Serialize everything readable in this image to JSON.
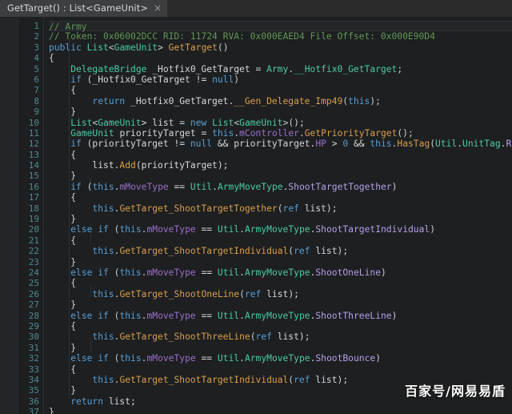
{
  "window": {
    "background_color": "#1d1f21",
    "accent_color": "#4ec9a7"
  },
  "tab_bar": {
    "tabs": [
      {
        "label": "GetTarget() : List<GameUnit>",
        "close_icon": "×",
        "active": true
      }
    ]
  },
  "editor": {
    "language": "csharp",
    "current_line": 1,
    "line_numbers": [
      "1",
      "2",
      "3",
      "4",
      "5",
      "6",
      "7",
      "8",
      "9",
      "10",
      "11",
      "12",
      "13",
      "14",
      "15",
      "16",
      "17",
      "18",
      "19",
      "20",
      "21",
      "22",
      "23",
      "24",
      "25",
      "26",
      "27",
      "28",
      "29",
      "30",
      "31",
      "32",
      "33",
      "34",
      "35",
      "36",
      "37"
    ],
    "colors": {
      "comment": "#629755",
      "keyword": "#5a9fd4",
      "type": "#4ec9a7",
      "method": "#d99f4b",
      "field": "#9b6fc9",
      "enum_member": "#b6a0e8",
      "number": "#6897bb",
      "plain": "#d8d8d8",
      "line_number": "#4f8a8b",
      "gutter_bg": "#1d1f21",
      "editor_bg": "#1d1f21",
      "current_line_bg": "#232629"
    },
    "lines": [
      {
        "n": 1,
        "tokens": [
          {
            "t": "// Army",
            "c": "cmt"
          }
        ]
      },
      {
        "n": 2,
        "tokens": [
          {
            "t": "// Token: 0x06002DCC RID: 11724 RVA: 0x000EAED4 File Offset: 0x000E90D4",
            "c": "cmt"
          }
        ]
      },
      {
        "n": 3,
        "tokens": [
          {
            "t": "public ",
            "c": "kw"
          },
          {
            "t": "List",
            "c": "type"
          },
          {
            "t": "<",
            "c": "punc"
          },
          {
            "t": "GameUnit",
            "c": "type"
          },
          {
            "t": "> ",
            "c": "punc"
          },
          {
            "t": "GetTarget",
            "c": "fn"
          },
          {
            "t": "()",
            "c": "punc"
          }
        ]
      },
      {
        "n": 4,
        "tokens": [
          {
            "t": "{",
            "c": "punc"
          }
        ]
      },
      {
        "n": 5,
        "tokens": [
          {
            "t": "    ",
            "c": "plain"
          },
          {
            "t": "DelegateBridge",
            "c": "type"
          },
          {
            "t": " _Hotfix0_GetTarget = ",
            "c": "plain"
          },
          {
            "t": "Army",
            "c": "type"
          },
          {
            "t": ".",
            "c": "punc"
          },
          {
            "t": "__Hotfix0_GetTarget",
            "c": "type"
          },
          {
            "t": ";",
            "c": "punc"
          }
        ]
      },
      {
        "n": 6,
        "tokens": [
          {
            "t": "    ",
            "c": "plain"
          },
          {
            "t": "if",
            "c": "kw"
          },
          {
            "t": " (_Hotfix0_GetTarget != ",
            "c": "plain"
          },
          {
            "t": "null",
            "c": "kw"
          },
          {
            "t": ")",
            "c": "punc"
          }
        ]
      },
      {
        "n": 7,
        "tokens": [
          {
            "t": "    {",
            "c": "punc"
          }
        ]
      },
      {
        "n": 8,
        "tokens": [
          {
            "t": "        ",
            "c": "plain"
          },
          {
            "t": "return",
            "c": "kw"
          },
          {
            "t": " _Hotfix0_GetTarget.",
            "c": "plain"
          },
          {
            "t": "__Gen_Delegate_Imp49",
            "c": "fn"
          },
          {
            "t": "(",
            "c": "punc"
          },
          {
            "t": "this",
            "c": "kw"
          },
          {
            "t": ");",
            "c": "punc"
          }
        ]
      },
      {
        "n": 9,
        "tokens": [
          {
            "t": "    }",
            "c": "punc"
          }
        ]
      },
      {
        "n": 10,
        "tokens": [
          {
            "t": "    ",
            "c": "plain"
          },
          {
            "t": "List",
            "c": "type"
          },
          {
            "t": "<",
            "c": "punc"
          },
          {
            "t": "GameUnit",
            "c": "type"
          },
          {
            "t": "> list = ",
            "c": "plain"
          },
          {
            "t": "new",
            "c": "kw"
          },
          {
            "t": " ",
            "c": "plain"
          },
          {
            "t": "List",
            "c": "type"
          },
          {
            "t": "<",
            "c": "punc"
          },
          {
            "t": "GameUnit",
            "c": "type"
          },
          {
            "t": ">();",
            "c": "punc"
          }
        ]
      },
      {
        "n": 11,
        "tokens": [
          {
            "t": "    ",
            "c": "plain"
          },
          {
            "t": "GameUnit",
            "c": "type"
          },
          {
            "t": " priorityTarget = ",
            "c": "plain"
          },
          {
            "t": "this",
            "c": "kw"
          },
          {
            "t": ".",
            "c": "punc"
          },
          {
            "t": "mController",
            "c": "field"
          },
          {
            "t": ".",
            "c": "punc"
          },
          {
            "t": "GetPriorityTarget",
            "c": "fn"
          },
          {
            "t": "();",
            "c": "punc"
          }
        ]
      },
      {
        "n": 12,
        "tokens": [
          {
            "t": "    ",
            "c": "plain"
          },
          {
            "t": "if",
            "c": "kw"
          },
          {
            "t": " (priorityTarget != ",
            "c": "plain"
          },
          {
            "t": "null",
            "c": "kw"
          },
          {
            "t": " && priorityTarget.",
            "c": "plain"
          },
          {
            "t": "HP",
            "c": "field"
          },
          {
            "t": " > ",
            "c": "plain"
          },
          {
            "t": "0",
            "c": "num"
          },
          {
            "t": " && ",
            "c": "plain"
          },
          {
            "t": "this",
            "c": "kw"
          },
          {
            "t": ".",
            "c": "punc"
          },
          {
            "t": "HasTag",
            "c": "fn"
          },
          {
            "t": "(",
            "c": "punc"
          },
          {
            "t": "Util",
            "c": "type"
          },
          {
            "t": ".",
            "c": "punc"
          },
          {
            "t": "UnitTag",
            "c": "type"
          },
          {
            "t": ".",
            "c": "punc"
          },
          {
            "t": "Ranger",
            "c": "enum"
          },
          {
            "t": "))",
            "c": "punc"
          }
        ]
      },
      {
        "n": 13,
        "tokens": [
          {
            "t": "    {",
            "c": "punc"
          }
        ]
      },
      {
        "n": 14,
        "tokens": [
          {
            "t": "        list.",
            "c": "plain"
          },
          {
            "t": "Add",
            "c": "fn"
          },
          {
            "t": "(priorityTarget);",
            "c": "plain"
          }
        ]
      },
      {
        "n": 15,
        "tokens": [
          {
            "t": "    }",
            "c": "punc"
          }
        ]
      },
      {
        "n": 16,
        "tokens": [
          {
            "t": "    ",
            "c": "plain"
          },
          {
            "t": "if",
            "c": "kw"
          },
          {
            "t": " (",
            "c": "punc"
          },
          {
            "t": "this",
            "c": "kw"
          },
          {
            "t": ".",
            "c": "punc"
          },
          {
            "t": "mMoveType",
            "c": "field"
          },
          {
            "t": " == ",
            "c": "plain"
          },
          {
            "t": "Util",
            "c": "type"
          },
          {
            "t": ".",
            "c": "punc"
          },
          {
            "t": "ArmyMoveType",
            "c": "type"
          },
          {
            "t": ".",
            "c": "punc"
          },
          {
            "t": "ShootTargetTogether",
            "c": "enum"
          },
          {
            "t": ")",
            "c": "punc"
          }
        ]
      },
      {
        "n": 17,
        "tokens": [
          {
            "t": "    {",
            "c": "punc"
          }
        ]
      },
      {
        "n": 18,
        "tokens": [
          {
            "t": "        ",
            "c": "plain"
          },
          {
            "t": "this",
            "c": "kw"
          },
          {
            "t": ".",
            "c": "punc"
          },
          {
            "t": "GetTarget_ShootTargetTogether",
            "c": "fn"
          },
          {
            "t": "(",
            "c": "punc"
          },
          {
            "t": "ref",
            "c": "kw"
          },
          {
            "t": " list);",
            "c": "plain"
          }
        ]
      },
      {
        "n": 19,
        "tokens": [
          {
            "t": "    }",
            "c": "punc"
          }
        ]
      },
      {
        "n": 20,
        "tokens": [
          {
            "t": "    ",
            "c": "plain"
          },
          {
            "t": "else if",
            "c": "kw"
          },
          {
            "t": " (",
            "c": "punc"
          },
          {
            "t": "this",
            "c": "kw"
          },
          {
            "t": ".",
            "c": "punc"
          },
          {
            "t": "mMoveType",
            "c": "field"
          },
          {
            "t": " == ",
            "c": "plain"
          },
          {
            "t": "Util",
            "c": "type"
          },
          {
            "t": ".",
            "c": "punc"
          },
          {
            "t": "ArmyMoveType",
            "c": "type"
          },
          {
            "t": ".",
            "c": "punc"
          },
          {
            "t": "ShootTargetIndividual",
            "c": "enum"
          },
          {
            "t": ")",
            "c": "punc"
          }
        ]
      },
      {
        "n": 21,
        "tokens": [
          {
            "t": "    {",
            "c": "punc"
          }
        ]
      },
      {
        "n": 22,
        "tokens": [
          {
            "t": "        ",
            "c": "plain"
          },
          {
            "t": "this",
            "c": "kw"
          },
          {
            "t": ".",
            "c": "punc"
          },
          {
            "t": "GetTarget_ShootTargetIndividual",
            "c": "fn"
          },
          {
            "t": "(",
            "c": "punc"
          },
          {
            "t": "ref",
            "c": "kw"
          },
          {
            "t": " list);",
            "c": "plain"
          }
        ]
      },
      {
        "n": 23,
        "tokens": [
          {
            "t": "    }",
            "c": "punc"
          }
        ]
      },
      {
        "n": 24,
        "tokens": [
          {
            "t": "    ",
            "c": "plain"
          },
          {
            "t": "else if",
            "c": "kw"
          },
          {
            "t": " (",
            "c": "punc"
          },
          {
            "t": "this",
            "c": "kw"
          },
          {
            "t": ".",
            "c": "punc"
          },
          {
            "t": "mMoveType",
            "c": "field"
          },
          {
            "t": " == ",
            "c": "plain"
          },
          {
            "t": "Util",
            "c": "type"
          },
          {
            "t": ".",
            "c": "punc"
          },
          {
            "t": "ArmyMoveType",
            "c": "type"
          },
          {
            "t": ".",
            "c": "punc"
          },
          {
            "t": "ShootOneLine",
            "c": "enum"
          },
          {
            "t": ")",
            "c": "punc"
          }
        ]
      },
      {
        "n": 25,
        "tokens": [
          {
            "t": "    {",
            "c": "punc"
          }
        ]
      },
      {
        "n": 26,
        "tokens": [
          {
            "t": "        ",
            "c": "plain"
          },
          {
            "t": "this",
            "c": "kw"
          },
          {
            "t": ".",
            "c": "punc"
          },
          {
            "t": "GetTarget_ShootOneLine",
            "c": "fn"
          },
          {
            "t": "(",
            "c": "punc"
          },
          {
            "t": "ref",
            "c": "kw"
          },
          {
            "t": " list);",
            "c": "plain"
          }
        ]
      },
      {
        "n": 27,
        "tokens": [
          {
            "t": "    }",
            "c": "punc"
          }
        ]
      },
      {
        "n": 28,
        "tokens": [
          {
            "t": "    ",
            "c": "plain"
          },
          {
            "t": "else if",
            "c": "kw"
          },
          {
            "t": " (",
            "c": "punc"
          },
          {
            "t": "this",
            "c": "kw"
          },
          {
            "t": ".",
            "c": "punc"
          },
          {
            "t": "mMoveType",
            "c": "field"
          },
          {
            "t": " == ",
            "c": "plain"
          },
          {
            "t": "Util",
            "c": "type"
          },
          {
            "t": ".",
            "c": "punc"
          },
          {
            "t": "ArmyMoveType",
            "c": "type"
          },
          {
            "t": ".",
            "c": "punc"
          },
          {
            "t": "ShootThreeLine",
            "c": "enum"
          },
          {
            "t": ")",
            "c": "punc"
          }
        ]
      },
      {
        "n": 29,
        "tokens": [
          {
            "t": "    {",
            "c": "punc"
          }
        ]
      },
      {
        "n": 30,
        "tokens": [
          {
            "t": "        ",
            "c": "plain"
          },
          {
            "t": "this",
            "c": "kw"
          },
          {
            "t": ".",
            "c": "punc"
          },
          {
            "t": "GetTarget_ShootThreeLine",
            "c": "fn"
          },
          {
            "t": "(",
            "c": "punc"
          },
          {
            "t": "ref",
            "c": "kw"
          },
          {
            "t": " list);",
            "c": "plain"
          }
        ]
      },
      {
        "n": 31,
        "tokens": [
          {
            "t": "    }",
            "c": "punc"
          }
        ]
      },
      {
        "n": 32,
        "tokens": [
          {
            "t": "    ",
            "c": "plain"
          },
          {
            "t": "else if",
            "c": "kw"
          },
          {
            "t": " (",
            "c": "punc"
          },
          {
            "t": "this",
            "c": "kw"
          },
          {
            "t": ".",
            "c": "punc"
          },
          {
            "t": "mMoveType",
            "c": "field"
          },
          {
            "t": " == ",
            "c": "plain"
          },
          {
            "t": "Util",
            "c": "type"
          },
          {
            "t": ".",
            "c": "punc"
          },
          {
            "t": "ArmyMoveType",
            "c": "type"
          },
          {
            "t": ".",
            "c": "punc"
          },
          {
            "t": "ShootBounce",
            "c": "enum"
          },
          {
            "t": ")",
            "c": "punc"
          }
        ]
      },
      {
        "n": 33,
        "tokens": [
          {
            "t": "    {",
            "c": "punc"
          }
        ]
      },
      {
        "n": 34,
        "tokens": [
          {
            "t": "        ",
            "c": "plain"
          },
          {
            "t": "this",
            "c": "kw"
          },
          {
            "t": ".",
            "c": "punc"
          },
          {
            "t": "GetTarget_ShootTargetIndividual",
            "c": "fn"
          },
          {
            "t": "(",
            "c": "punc"
          },
          {
            "t": "ref",
            "c": "kw"
          },
          {
            "t": " list);",
            "c": "plain"
          }
        ]
      },
      {
        "n": 35,
        "tokens": [
          {
            "t": "    }",
            "c": "punc"
          }
        ]
      },
      {
        "n": 36,
        "tokens": [
          {
            "t": "    ",
            "c": "plain"
          },
          {
            "t": "return",
            "c": "kw"
          },
          {
            "t": " list;",
            "c": "plain"
          }
        ]
      },
      {
        "n": 37,
        "tokens": [
          {
            "t": "}",
            "c": "punc"
          }
        ]
      }
    ]
  },
  "watermark": {
    "text": "百家号/网易易盾"
  }
}
